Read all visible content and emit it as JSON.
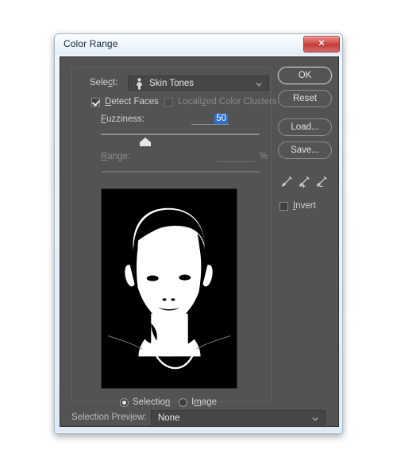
{
  "window": {
    "title": "Color Range",
    "close_label": "✕"
  },
  "select": {
    "label": "Select:",
    "value": "Skin Tones",
    "icon": "person-icon",
    "chevron": "chevron-down-icon"
  },
  "checkboxes": {
    "detect_faces_label": "Detect Faces",
    "detect_faces_checked": true,
    "localized_color_clusters_label": "Localized Color Clusters",
    "localized_color_clusters_checked": false,
    "localized_color_clusters_disabled": true
  },
  "fuzziness": {
    "label": "Fuzziness:",
    "value": "50",
    "slider_percent": 28,
    "selected": true
  },
  "range": {
    "label": "Range:",
    "value": "",
    "unit": "%",
    "disabled": true,
    "slider_percent": 0
  },
  "preview": {
    "mode_selection_label": "Selection",
    "mode_image_label": "Image",
    "mode": "Selection"
  },
  "buttons": {
    "ok": "OK",
    "reset": "Reset",
    "load": "Load...",
    "save": "Save..."
  },
  "eyedroppers": {
    "sample": "eyedropper-icon",
    "add": "eyedropper-plus-icon",
    "subtract": "eyedropper-minus-icon"
  },
  "invert": {
    "label": "Invert",
    "checked": false
  },
  "selection_preview": {
    "label": "Selection Preview:",
    "value": "None",
    "chevron": "chevron-down-icon"
  },
  "colors": {
    "dialog_background": "#535353",
    "title_bar": "#eef5fb",
    "close_button": "#c23b37",
    "highlight_blue": "#2a6fd4",
    "text": "#d7d7d7",
    "text_disabled": "#8a8a8a",
    "preview_black": "#000000",
    "preview_white": "#ffffff"
  }
}
